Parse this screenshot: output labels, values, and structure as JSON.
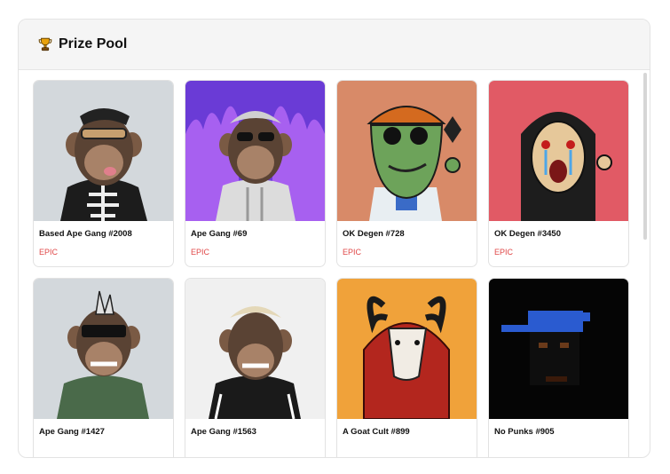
{
  "panel": {
    "title": "Prize Pool",
    "icon": "trophy-icon"
  },
  "colors": {
    "rarity_epic": "#e04848",
    "header_bg": "#f5f5f5"
  },
  "cards": [
    {
      "name": "Based Ape Gang #2008",
      "rarity": "EPIC",
      "bg": "#d3d8dc"
    },
    {
      "name": "Ape Gang #69",
      "rarity": "EPIC",
      "bg": "#6a3bd6"
    },
    {
      "name": "OK Degen #728",
      "rarity": "EPIC",
      "bg": "#d88a68"
    },
    {
      "name": "OK Degen #3450",
      "rarity": "EPIC",
      "bg": "#e15a65"
    },
    {
      "name": "Ape Gang #1427",
      "rarity": "",
      "bg": "#d3d8dc"
    },
    {
      "name": "Ape Gang #1563",
      "rarity": "",
      "bg": "#f0f0f0"
    },
    {
      "name": "A Goat Cult #899",
      "rarity": "",
      "bg": "#f0a23a"
    },
    {
      "name": "No Punks #905",
      "rarity": "",
      "bg": "#050505"
    }
  ]
}
